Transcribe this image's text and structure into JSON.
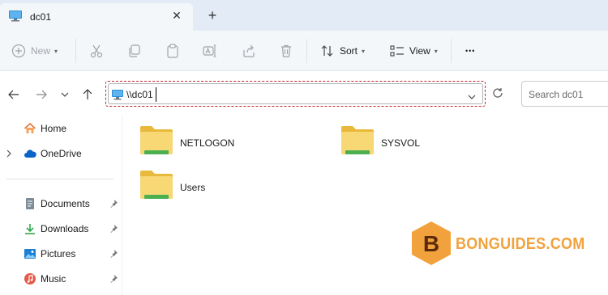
{
  "tab": {
    "title": "dc01",
    "close_glyph": "✕",
    "add_glyph": "+"
  },
  "toolbar": {
    "new_label": "New",
    "sort_label": "Sort",
    "view_label": "View",
    "more_glyph": "•••"
  },
  "address": {
    "path": "\\\\dc01"
  },
  "search": {
    "placeholder": "Search dc01"
  },
  "sidebar": {
    "items": [
      {
        "label": "Home",
        "icon": "home-icon"
      },
      {
        "label": "OneDrive",
        "icon": "cloud-icon"
      },
      {
        "label": "Documents",
        "icon": "documents-icon",
        "pinned": true
      },
      {
        "label": "Downloads",
        "icon": "download-icon",
        "pinned": true
      },
      {
        "label": "Pictures",
        "icon": "pictures-icon",
        "pinned": true
      },
      {
        "label": "Music",
        "icon": "music-icon",
        "pinned": true
      }
    ]
  },
  "folders": [
    {
      "name": "NETLOGON"
    },
    {
      "name": "SYSVOL"
    },
    {
      "name": "Users"
    }
  ],
  "watermark": {
    "letter": "B",
    "text": "BONGUIDES.COM"
  },
  "colors": {
    "accent": "#0067c0",
    "highlight_dash": "#c0262d",
    "folder_yellow": "#f8d775",
    "folder_green": "#4caf50",
    "watermark_orange": "#f2a23c"
  }
}
